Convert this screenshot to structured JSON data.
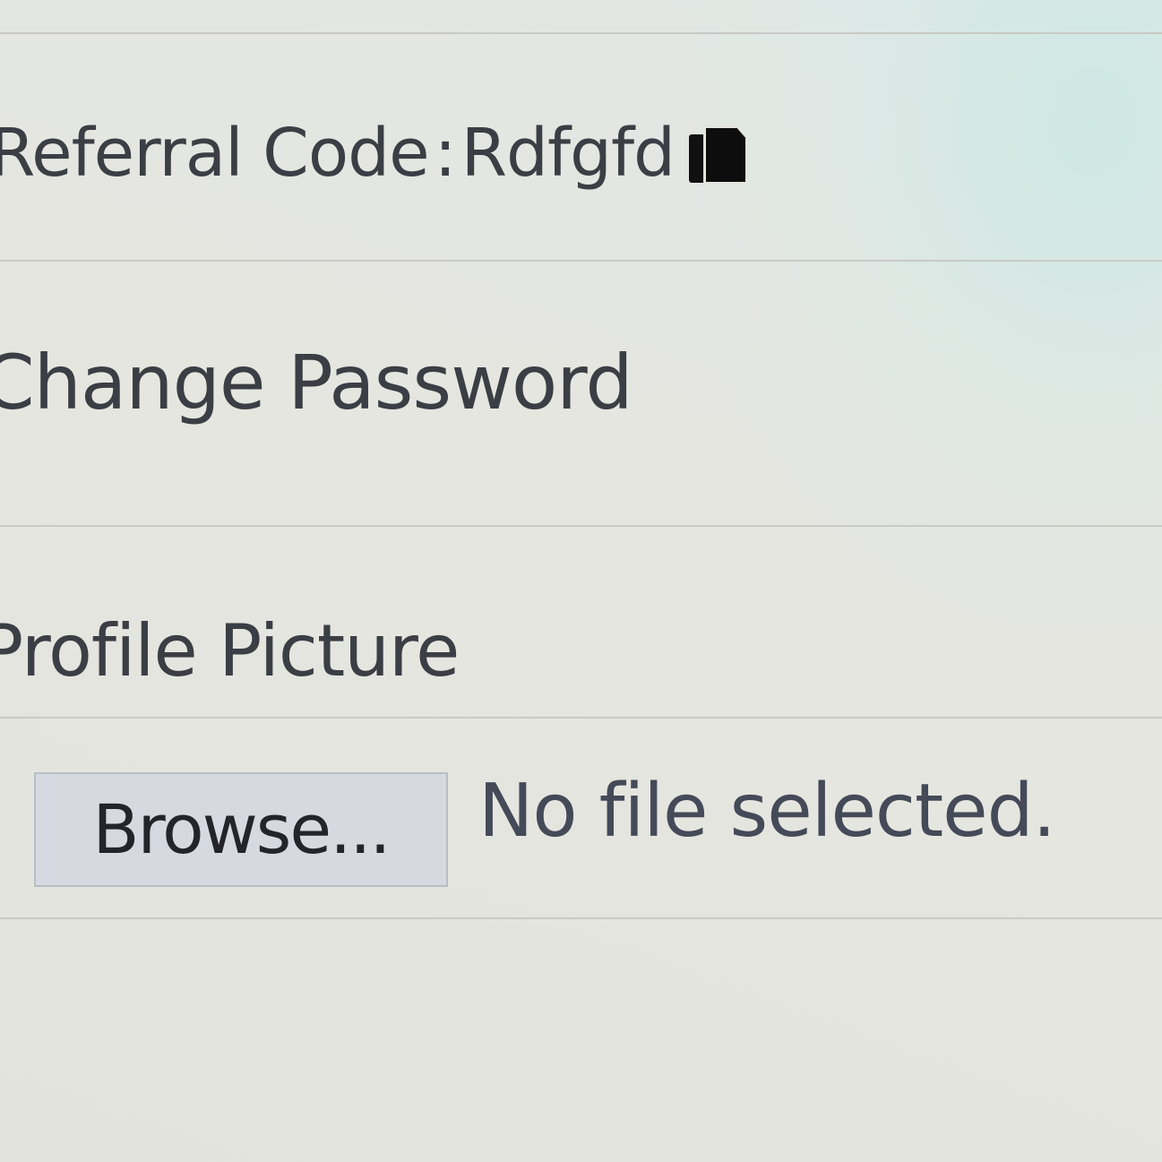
{
  "profile": {
    "referral_label": "Referral Code",
    "referral_separator": ":",
    "referral_code": "Rdfgfd",
    "copy_icon": "copy-icon",
    "change_password_label": "Change Password",
    "profile_picture_label": "Profile Picture",
    "browse_label": "Browse...",
    "file_status": "No file selected."
  },
  "colors": {
    "background": "#e4e6e1",
    "text": "#3b3e44",
    "button_bg": "#d6dae0",
    "divider": "#c9cac4"
  }
}
